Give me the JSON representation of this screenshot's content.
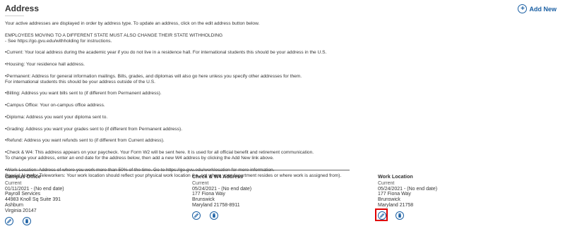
{
  "header": {
    "title": "Address",
    "add_new_label": "Add New",
    "add_new_icon": "plus-circle-icon"
  },
  "info_paragraphs": [
    "Your active addresses are displayed in order by address type.  To update an address, click on the edit address button below.",
    "EMPLOYEES MOVING TO A DIFFERENT STATE MUST ALSO CHANGE THEIR STATE WITHHOLDING\n- See https://go.gvu.edu/withholding for instructions.",
    "•Current: Your local address during the academic year if you do not live in a residence hall. For international students this should be your address in the U.S.",
    "•Housing: Your residence hall address.",
    "•Permanent: Address for general information mailings. Bills, grades, and diplomas will also go here unless you specify other addresses for them.\nFor international students this should be your address outside of the U.S.",
    "•Billing: Address you want bills sent to (if different from Permanent address).",
    "•Campus Office: Your on-campus office address.",
    "•Diploma: Address you want your diploma sent to.",
    "•Grading: Address you want your grades sent to (if different from Permanent address).",
    "•Refund: Address you want refunds sent to (if different from Current address).",
    "•Check & W4: This address appears on your paycheck. Your Form W2 will be sent here. It is used for all official benefit and retirement communication.\nTo change your address, enter an end date for the address below, then add a new W4 address by clicking the Add New link above.",
    "•Work Location: Address of where you work more than 50% of the time. Go to https://go.gvu.edu/worklocation for more information.\nSpecial Note for Teleworkers: Your work location should reflect your physical work location (i.e. not where your department resides or where work is assigned from)."
  ],
  "addresses": [
    {
      "name": "Campus Office",
      "status": "Current",
      "dates": "01/11/2021 - (No end date)",
      "line1": "Payroll Services",
      "line2": "44983 Knoll Sq Suite 391",
      "city": "Ashburn",
      "state_zip": "Virginia 20147"
    },
    {
      "name": "Check & W4 Address",
      "status": "Current",
      "dates": "05/24/2021 - (No end date)",
      "line1": "177 Fiona Way",
      "city": "Brunswick",
      "state_zip": "Maryland 21758-8911"
    },
    {
      "name": "Work Location",
      "status": "Current",
      "dates": "05/24/2021 - (No end date)",
      "line1": "177 Fiona Way",
      "city": "Brunswick",
      "state_zip": "Maryland 21758"
    }
  ],
  "icons": {
    "edit": "pencil-icon",
    "delete": "trash-icon"
  },
  "colors": {
    "accent": "#1a5fa3",
    "highlight": "#e00000"
  }
}
